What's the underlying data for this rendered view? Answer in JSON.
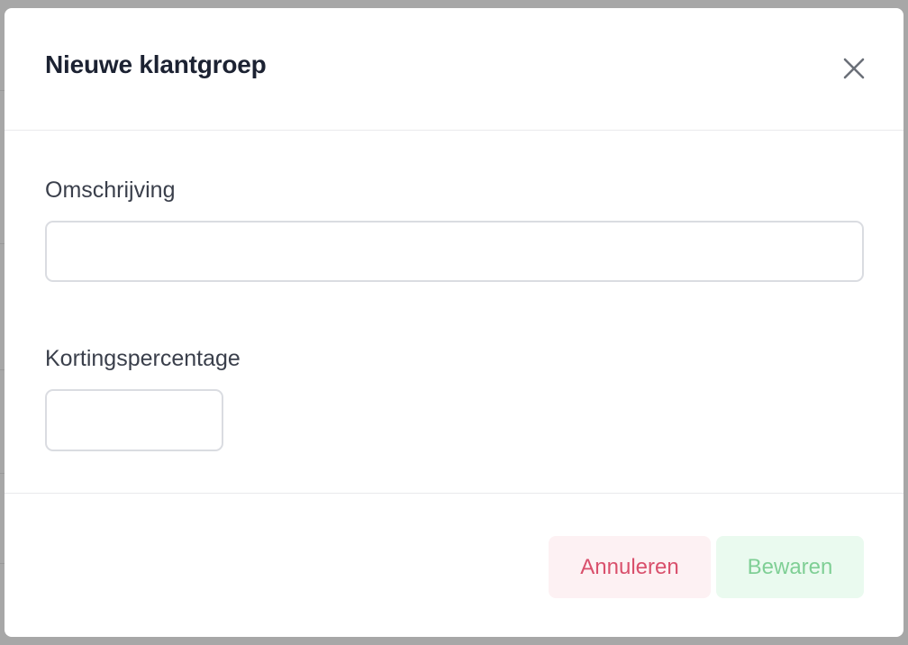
{
  "dialog": {
    "title": "Nieuwe klantgroep",
    "close_icon": "close-icon"
  },
  "form": {
    "description": {
      "label": "Omschrijving",
      "value": "",
      "placeholder": ""
    },
    "discount": {
      "label": "Kortingspercentage",
      "value": "",
      "placeholder": ""
    }
  },
  "footer": {
    "cancel_label": "Annuleren",
    "save_label": "Bewaren"
  },
  "colors": {
    "cancel_text": "#d9506c",
    "cancel_bg": "#fdf1f3",
    "save_text": "#7fcf95",
    "save_bg": "#eafaef",
    "title_text": "#1c2232"
  }
}
